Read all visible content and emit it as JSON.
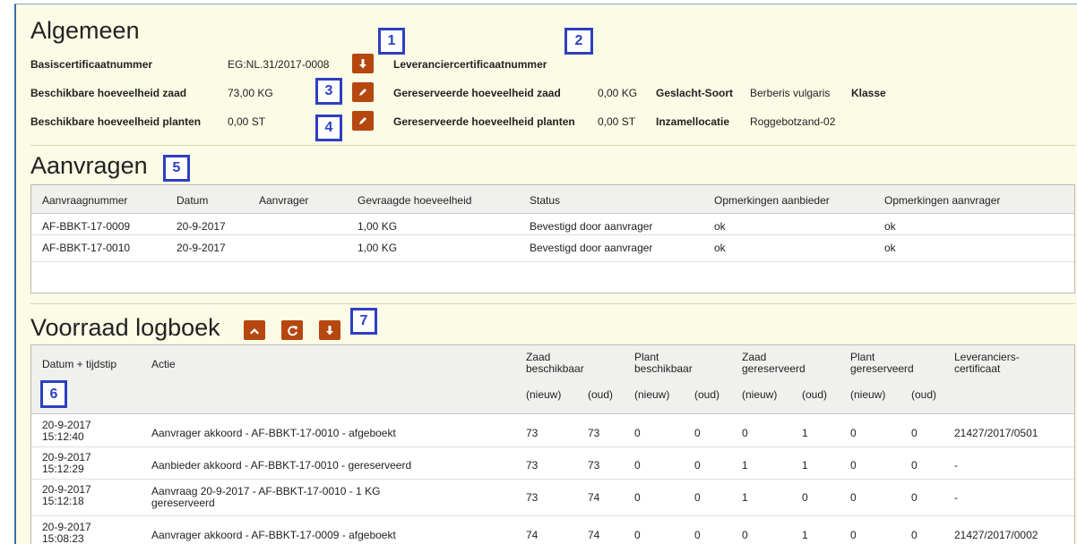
{
  "general": {
    "title": "Algemeen",
    "basecert_label": "Basiscertificaatnummer",
    "basecert_value": "EG:NL.31/2017-0008",
    "suppliercert_label": "Leveranciercertificaatnummer",
    "avail_seed_label": "Beschikbare hoeveelheid zaad",
    "avail_seed_value": "73,00 KG",
    "reserved_seed_label": "Gereserveerde hoeveelheid zaad",
    "reserved_seed_value": "0,00 KG",
    "species_label": "Geslacht-Soort",
    "species_value": "Berberis vulgaris",
    "class_label": "Klasse",
    "avail_plants_label": "Beschikbare hoeveelheid planten",
    "avail_plants_value": "0,00 ST",
    "reserved_plants_label": "Gereserveerde hoeveelheid planten",
    "reserved_plants_value": "0,00 ST",
    "location_label": "Inzamellocatie",
    "location_value": "Roggebotzand-02"
  },
  "callouts": [
    "1",
    "2",
    "3",
    "4",
    "5",
    "6",
    "7"
  ],
  "requests": {
    "title": "Aanvragen",
    "columns": [
      "Aanvraagnummer",
      "Datum",
      "Aanvrager",
      "Gevraagde hoeveelheid",
      "Status",
      "Opmerkingen aanbieder",
      "Opmerkingen aanvrager"
    ],
    "rows": [
      [
        "AF-BBKT-17-0009",
        "20-9-2017",
        "",
        "1,00 KG",
        "Bevestigd door aanvrager",
        "ok",
        "ok"
      ],
      [
        "AF-BBKT-17-0010",
        "20-9-2017",
        "",
        "1,00 KG",
        "Bevestigd door aanvrager",
        "ok",
        "ok"
      ]
    ]
  },
  "log": {
    "title": "Voorraad logboek",
    "columns": {
      "datetime": "Datum + tijdstip",
      "action": "Actie",
      "seed_avail_1": "Zaad",
      "seed_avail_2": "beschikbaar",
      "plant_avail_1": "Plant",
      "plant_avail_2": "beschikbaar",
      "seed_res_1": "Zaad",
      "seed_res_2": "gereserveerd",
      "plant_res_1": "Plant",
      "plant_res_2": "gereserveerd",
      "cert_1": "Leveranciers-",
      "cert_2": "certificaat",
      "new": "(nieuw)",
      "old": "(oud)"
    },
    "rows": [
      {
        "date": "20-9-2017",
        "time": "15:12:40",
        "action": "Aanvrager akkoord - AF-BBKT-17-0010 - afgeboekt",
        "action2": "",
        "v": [
          "73",
          "73",
          "0",
          "0",
          "0",
          "1",
          "0",
          "0"
        ],
        "cert": "21427/2017/0501"
      },
      {
        "date": "20-9-2017",
        "time": "15:12:29",
        "action": "Aanbieder akkoord - AF-BBKT-17-0010 - gereserveerd",
        "action2": "",
        "v": [
          "73",
          "73",
          "0",
          "0",
          "1",
          "1",
          "0",
          "0"
        ],
        "cert": "-"
      },
      {
        "date": "20-9-2017",
        "time": "15:12:18",
        "action": "Aanvraag  20-9-2017 - AF-BBKT-17-0010 - 1 KG",
        "action2": "gereserveerd",
        "v": [
          "73",
          "74",
          "0",
          "0",
          "1",
          "0",
          "0",
          "0"
        ],
        "cert": "-"
      },
      {
        "date": "20-9-2017",
        "time": "15:08:23",
        "action": "Aanvrager akkoord - AF-BBKT-17-0009 - afgeboekt",
        "action2": "",
        "v": [
          "74",
          "74",
          "0",
          "0",
          "0",
          "1",
          "0",
          "0"
        ],
        "cert": "21427/2017/0002"
      }
    ]
  },
  "icons": {
    "download": "download-arrow-icon",
    "edit": "pencil-icon",
    "collapse": "chevron-up-icon",
    "refresh": "refresh-icon"
  },
  "colors": {
    "button": "#b5470f",
    "callout": "#2d3fc0",
    "background": "#fbfbe6"
  }
}
